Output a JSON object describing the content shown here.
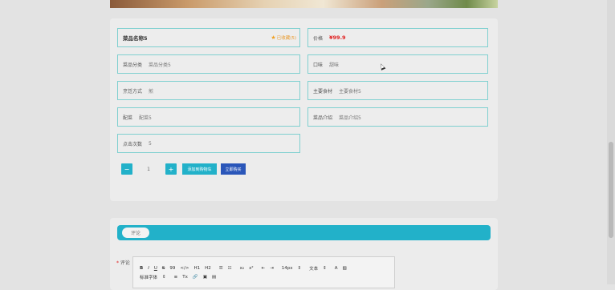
{
  "dish": {
    "name_label": "菜品名称5",
    "favorite": "已收藏(5)",
    "price_label": "价格",
    "price": "¥99.9",
    "category_label": "菜品分类",
    "category": "菜品分类5",
    "taste_label": "口味",
    "taste": "甜味",
    "cooking_label": "烹饪方式",
    "cooking": "煎",
    "main_ingredient_label": "主要食材",
    "main_ingredient": "主要食材5",
    "side_dish_label": "配菜",
    "side_dish": "配菜5",
    "intro_label": "菜品介绍",
    "intro": "菜品介绍5",
    "clicks_label": "点击次数",
    "clicks": "5"
  },
  "purchase": {
    "minus": "−",
    "quantity": "1",
    "plus": "+",
    "add_to_cart": "添加到购物车",
    "buy_now": "立即购买"
  },
  "comments": {
    "tab_label": "评论",
    "required_mark": "*",
    "field_label": "评论",
    "toolbar_row1": [
      "B",
      "I",
      "U",
      "S",
      "99",
      "</>",
      "H1",
      "H2",
      "☰",
      "☷",
      "x₂",
      "x²",
      "⇤",
      "⇥",
      "14px",
      "⇕",
      "文本",
      "⇕",
      "A",
      "▨"
    ],
    "toolbar_row2": [
      "标准字体",
      "⇕",
      "≡",
      "Tx",
      "🔗",
      "▣",
      "▤"
    ]
  },
  "colors": {
    "accent": "#22b1c9",
    "buy_button": "#2a56b9",
    "price": "#e02020",
    "favorite": "#e99a2c",
    "field_border": "#7fd0d0"
  }
}
